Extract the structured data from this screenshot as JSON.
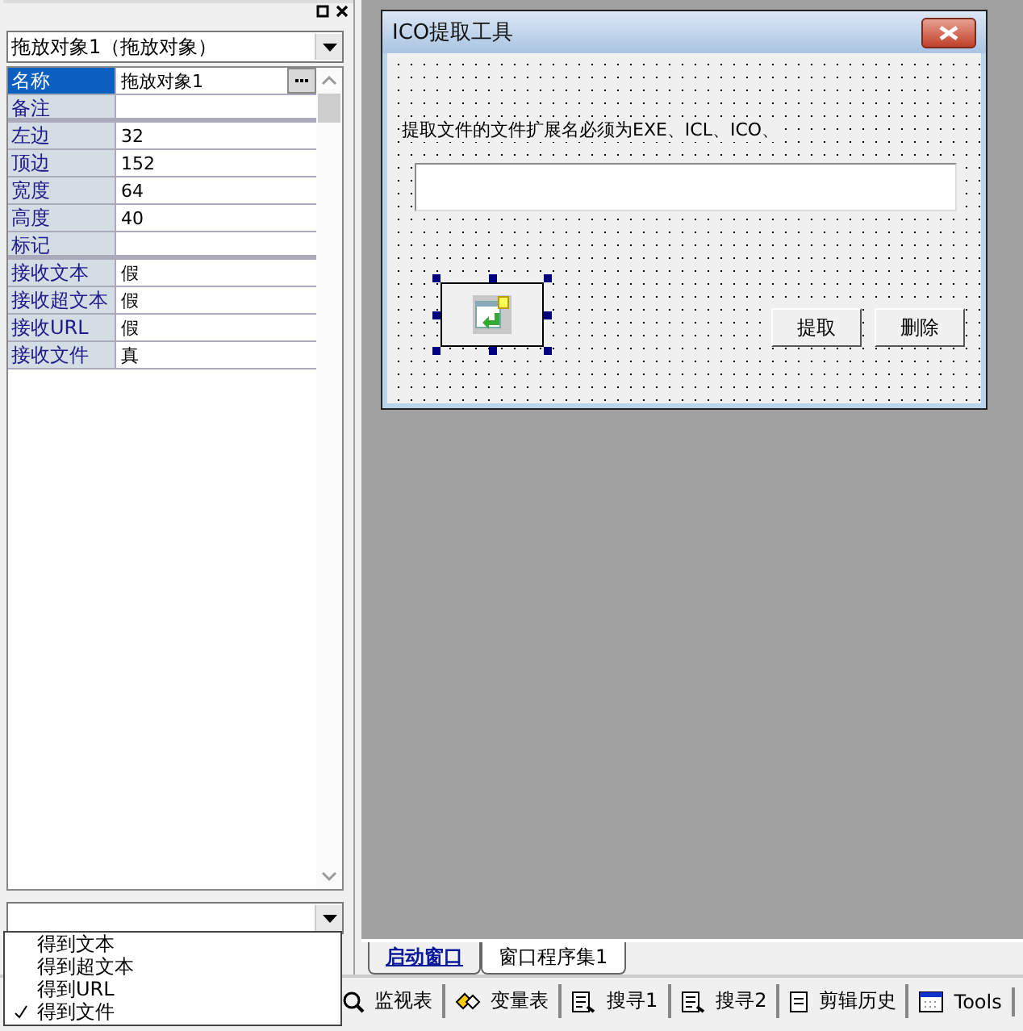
{
  "object_selector": {
    "value": "拖放对象1（拖放对象）"
  },
  "properties": [
    {
      "name": "名称",
      "value": "拖放对象1",
      "selected": true,
      "has_button": true,
      "group_end": false
    },
    {
      "name": "备注",
      "selected": false,
      "has_button": false,
      "group_end": true
    },
    {
      "name": "左边",
      "value": "32",
      "selected": false,
      "has_button": false,
      "group_end": false
    },
    {
      "name": "顶边",
      "value": "152",
      "selected": false,
      "has_button": false,
      "group_end": false
    },
    {
      "name": "宽度",
      "value": "64",
      "selected": false,
      "has_button": false,
      "group_end": false
    },
    {
      "name": "高度",
      "value": "40",
      "selected": false,
      "has_button": false,
      "group_end": false
    },
    {
      "name": "标记",
      "selected": false,
      "has_button": false,
      "group_end": true
    },
    {
      "name": "接收文本",
      "value": "假",
      "selected": false,
      "has_button": false,
      "group_end": false
    },
    {
      "name": "接收超文本",
      "value": "假",
      "selected": false,
      "has_button": false,
      "group_end": false
    },
    {
      "name": "接收URL",
      "value": "假",
      "selected": false,
      "has_button": false,
      "group_end": false
    },
    {
      "name": "接收文件",
      "value": "真",
      "selected": false,
      "has_button": false,
      "group_end": false
    }
  ],
  "event_menu": {
    "items": [
      {
        "label": "得到文本",
        "checked": false
      },
      {
        "label": "得到超文本",
        "checked": false
      },
      {
        "label": "得到URL",
        "checked": false
      },
      {
        "label": "得到文件",
        "checked": true
      }
    ]
  },
  "form": {
    "title": "ICO提取工具",
    "label": "提取文件的文件扩展名必须为EXE、ICL、ICO、",
    "buttons": [
      "提取",
      "删除"
    ]
  },
  "editor_tabs": [
    {
      "label": "启动窗口",
      "selected": true
    },
    {
      "label": "窗口程序集1",
      "selected": false
    }
  ],
  "bottom_tabs": [
    {
      "label": "监视表",
      "kind": "watch"
    },
    {
      "label": "变量表",
      "kind": "variables"
    },
    {
      "label": "搜寻1",
      "kind": "find"
    },
    {
      "label": "搜寻2",
      "kind": "find"
    },
    {
      "label": "剪辑历史",
      "kind": "clipboard"
    },
    {
      "label": "Tools",
      "kind": "tools"
    }
  ]
}
